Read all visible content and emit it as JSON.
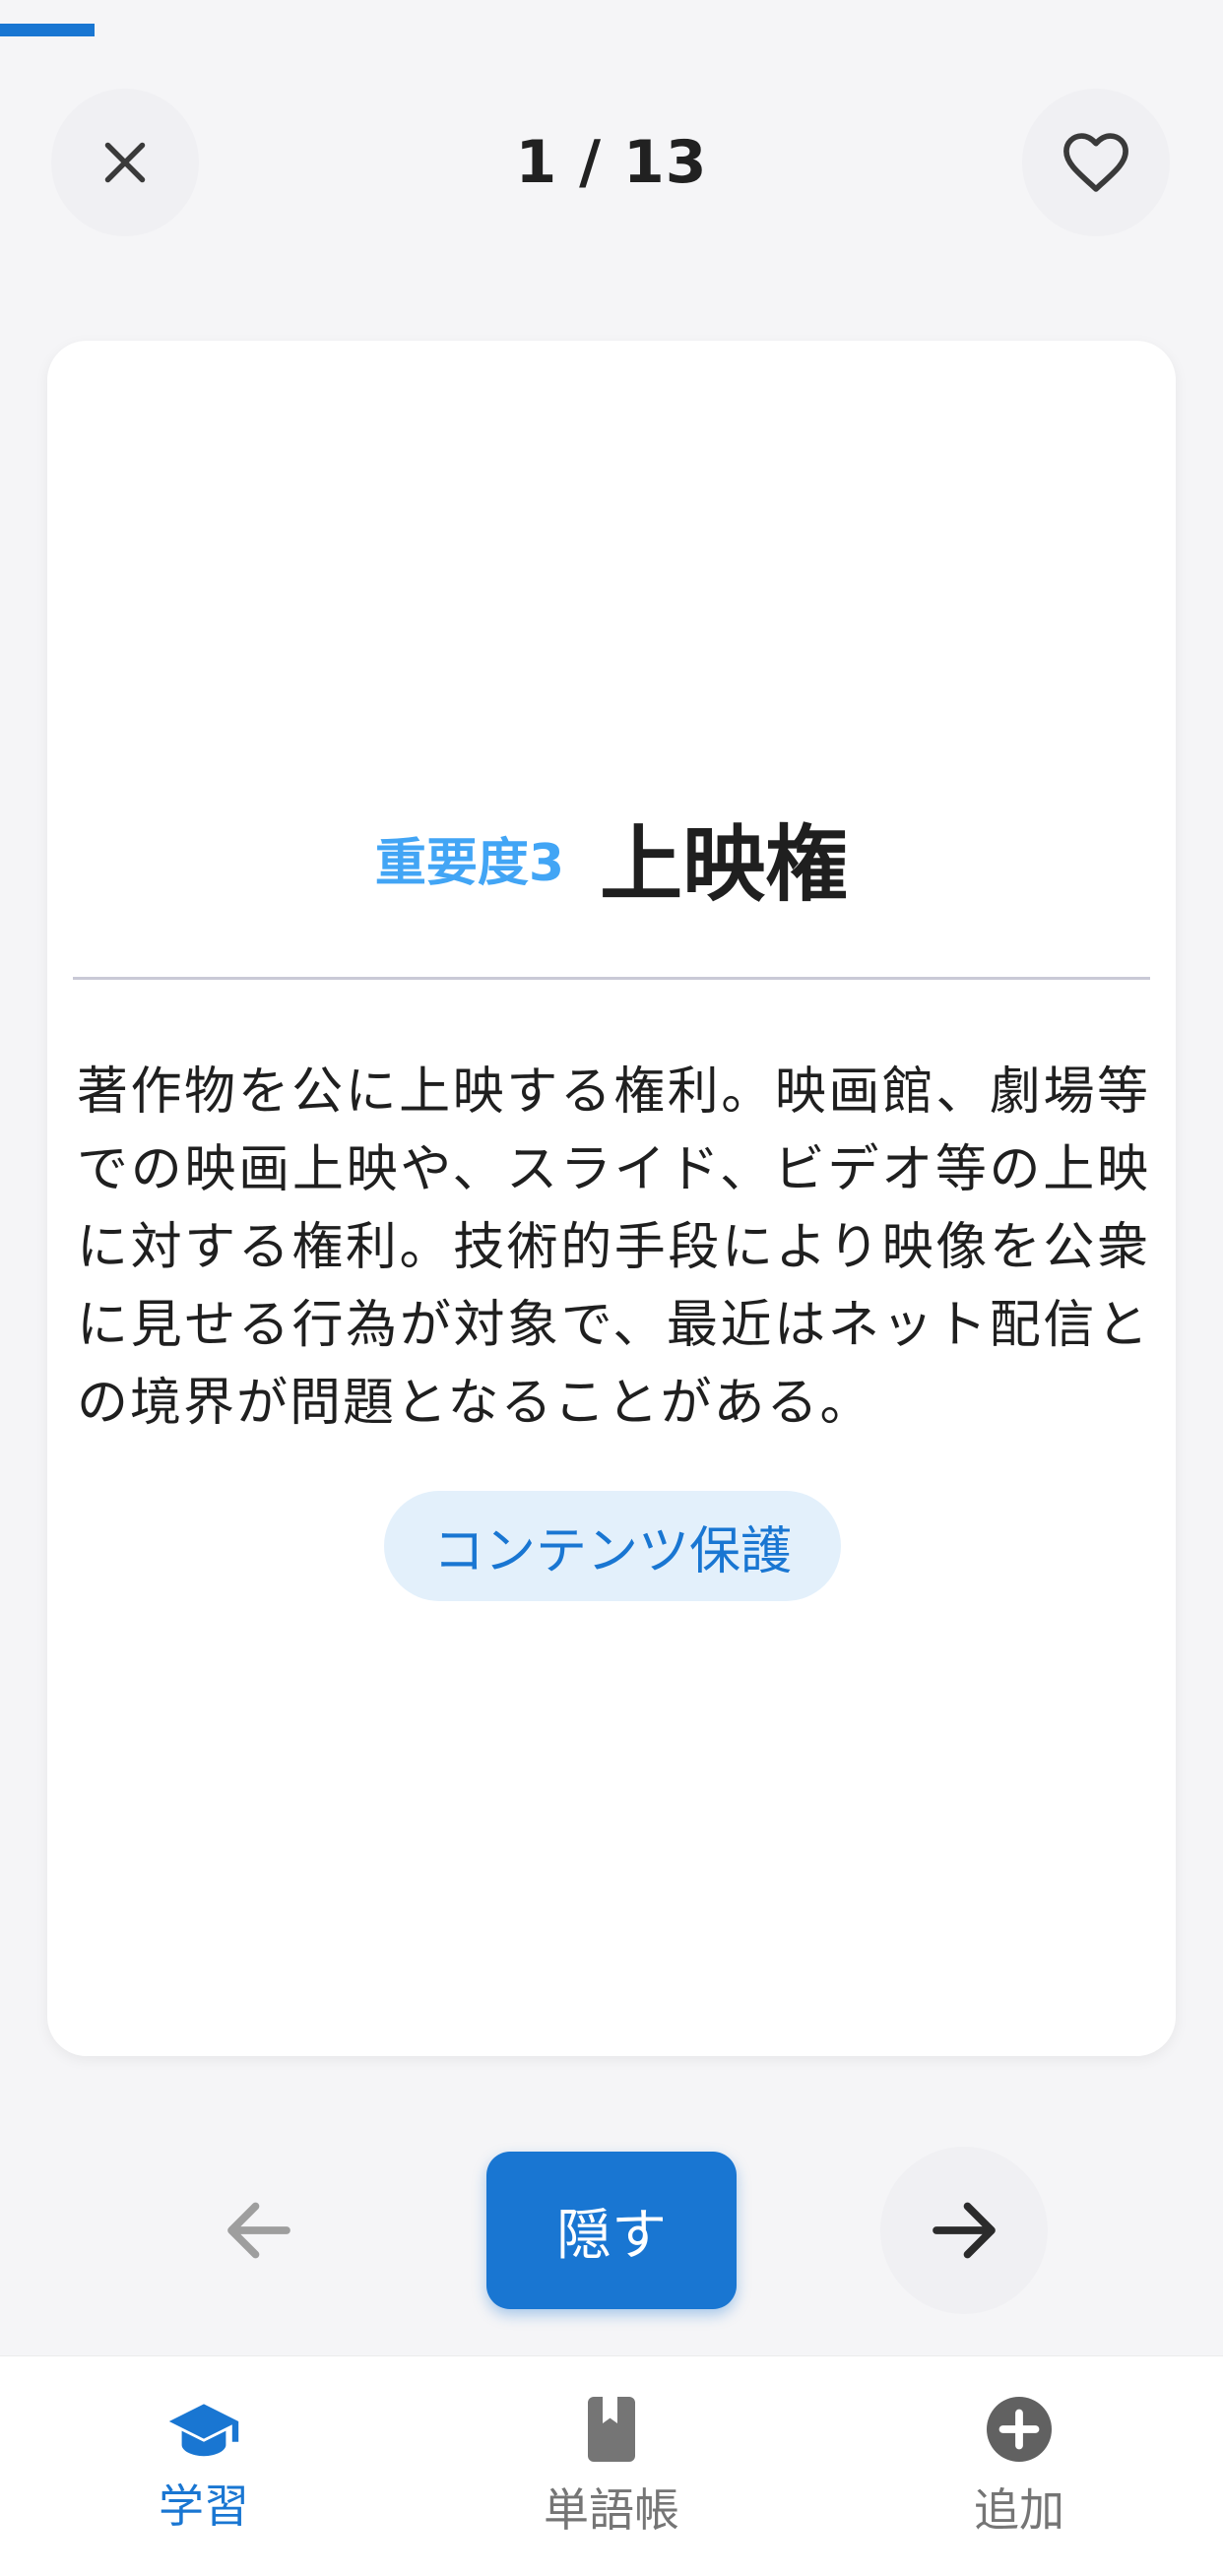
{
  "progress": {
    "current": 1,
    "total": 13,
    "fraction": 0.0769
  },
  "header": {
    "counter": "1 / 13"
  },
  "card": {
    "importance": "重要度3",
    "term": "上映権",
    "definition": "著作物を公に上映する権利。映画館、劇場等での映画上映や、スライド、ビデオ等の上映に対する権利。技術的手段により映像を公衆に見せる行為が対象で、最近はネット配信との境界が問題となることがある。",
    "tag": "コンテンツ保護"
  },
  "controls": {
    "hide_label": "隠す"
  },
  "bottom_nav": {
    "items": [
      {
        "label": "学習",
        "icon": "graduation-cap-icon",
        "active": true
      },
      {
        "label": "単語帳",
        "icon": "book-icon",
        "active": false
      },
      {
        "label": "追加",
        "icon": "add-circle-icon",
        "active": false
      }
    ]
  },
  "colors": {
    "accent": "#1976d2",
    "importance": "#42a5f5",
    "tag_bg": "#e3f0fb",
    "background": "#f5f5f7"
  }
}
